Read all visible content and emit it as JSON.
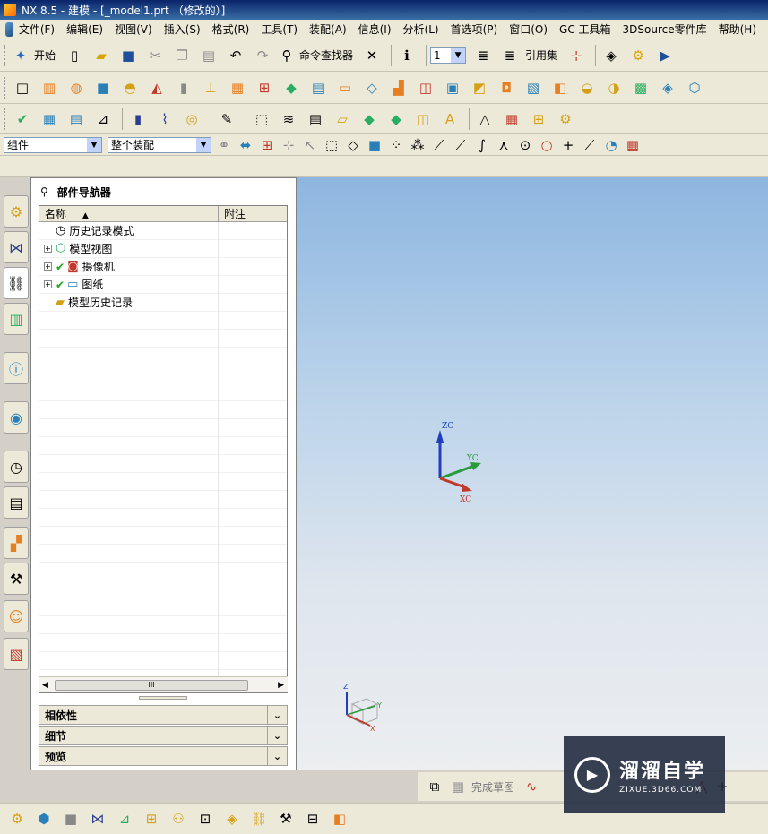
{
  "window": {
    "title": "NX 8.5 - 建模 - [_model1.prt （修改的）]"
  },
  "menu": [
    "文件(F)",
    "编辑(E)",
    "视图(V)",
    "插入(S)",
    "格式(R)",
    "工具(T)",
    "装配(A)",
    "信息(I)",
    "分析(L)",
    "首选项(P)",
    "窗口(O)",
    "GC 工具箱",
    "3DSource零件库",
    "帮助(H)"
  ],
  "toolbar1": {
    "start_label": "开始",
    "command_finder_label": "命令查找器",
    "layer_value": "1",
    "reference_set_label": "引用集"
  },
  "selection_bar": {
    "filter_value": "组件",
    "scope_value": "整个装配"
  },
  "navigator": {
    "title": "部件导航器",
    "columns": {
      "name": "名称",
      "note": "附注"
    },
    "nodes": [
      {
        "label": "历史记录模式",
        "icon": "clock-icon",
        "expandable": false,
        "checked": false
      },
      {
        "label": "模型视图",
        "icon": "model-views-icon",
        "expandable": true,
        "checked": false
      },
      {
        "label": "摄像机",
        "icon": "camera-icon",
        "expandable": true,
        "checked": true
      },
      {
        "label": "图纸",
        "icon": "drawing-sheet-icon",
        "expandable": true,
        "checked": true
      },
      {
        "label": "模型历史记录",
        "icon": "folder-icon",
        "expandable": false,
        "checked": false
      }
    ],
    "scroll_thumb": "III",
    "panels": [
      "相依性",
      "细节",
      "预览"
    ]
  },
  "viewport": {
    "axes": {
      "z": "ZC",
      "y": "YC",
      "x": "XC"
    },
    "mini_axes": {
      "z": "Z",
      "y": "Y",
      "x": "X"
    }
  },
  "sketch_bar": {
    "finish_sketch_label": "完成草图"
  },
  "watermark": {
    "text": "溜溜自学",
    "url": "ZIXUE.3D66.COM"
  }
}
